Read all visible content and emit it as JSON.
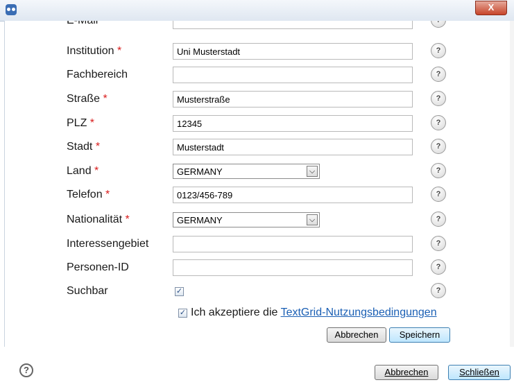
{
  "window": {
    "close_glyph": "X"
  },
  "form": {
    "email": {
      "label": "E-Mail"
    },
    "institution": {
      "label": "Institution",
      "value": "Uni Musterstadt"
    },
    "fachbereich": {
      "label": "Fachbereich",
      "value": ""
    },
    "strasse": {
      "label": "Straße",
      "value": "Musterstraße"
    },
    "plz": {
      "label": "PLZ",
      "value": "12345"
    },
    "stadt": {
      "label": "Stadt",
      "value": "Musterstadt"
    },
    "land": {
      "label": "Land",
      "value": "GERMANY"
    },
    "telefon": {
      "label": "Telefon",
      "value": "0123/456-789"
    },
    "nationalitaet": {
      "label": "Nationalität",
      "value": "GERMANY"
    },
    "interessengebiet": {
      "label": "Interessengebiet",
      "value": ""
    },
    "personen_id": {
      "label": "Personen-ID",
      "value": ""
    },
    "suchbar": {
      "label": "Suchbar",
      "checked": true
    },
    "required_marker": "*",
    "help_glyph": "?",
    "terms": {
      "checked": true,
      "text": "Ich akzeptiere die ",
      "link": "TextGrid-Nutzungsbedingungen"
    },
    "cancel_label": "Abbrechen",
    "save_label": "Speichern"
  },
  "footer": {
    "help_glyph": "?",
    "cancel_label": "Abbrechen",
    "close_label": "Schließen"
  },
  "colors": {
    "required": "#d91c1c",
    "link": "#1a5fb4",
    "close_button": "#c7452a"
  },
  "icons": {
    "app": "owl-app-icon",
    "help": "question-mark-icon",
    "dropdown": "chevron-down-icon"
  }
}
